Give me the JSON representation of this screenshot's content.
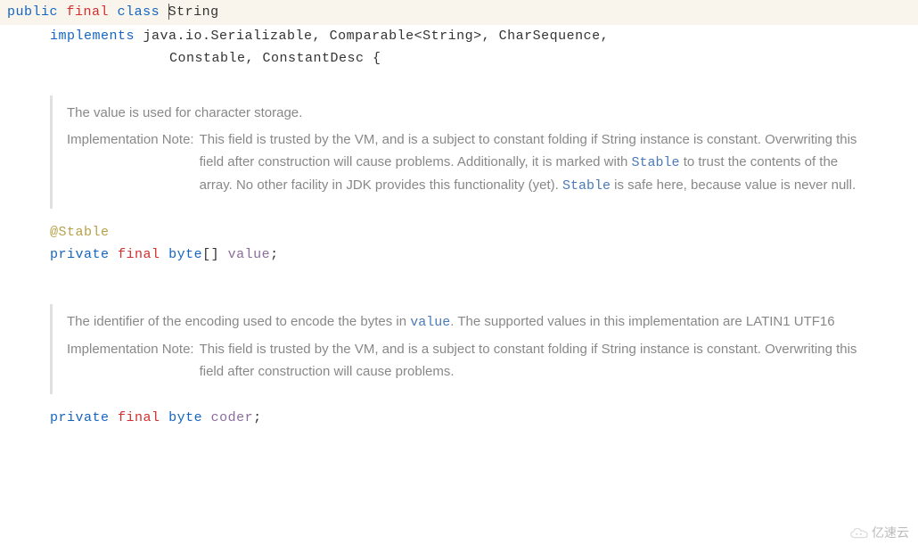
{
  "line1": {
    "public": "public",
    "final": "final",
    "class": "class",
    "name": "String"
  },
  "line2": {
    "implements": "implements",
    "types": "java.io.Serializable, Comparable<String>, CharSequence,"
  },
  "line3": {
    "types": "Constable, ConstantDesc {"
  },
  "doc1": {
    "intro": "The value is used for character storage.",
    "label": "Implementation Note:",
    "body_pre": "This field is trusted by the VM, and is a subject to constant folding if String instance is constant. Overwriting this field after construction will cause problems. Additionally, it is marked with ",
    "stable1": "Stable",
    "body_mid": " to trust the contents of the array. No other facility in JDK provides this functionality (yet). ",
    "stable2": "Stable",
    "body_post": " is safe here, because value is never null."
  },
  "decl1": {
    "annotation": "@Stable",
    "private": "private",
    "final": "final",
    "type": "byte",
    "brackets": "[]",
    "name": "value",
    "semi": ";"
  },
  "doc2": {
    "intro_pre": "The identifier of the encoding used to encode the bytes in ",
    "intro_code": "value",
    "intro_post": ". The supported values in this implementation are LATIN1 UTF16",
    "label": "Implementation Note:",
    "body": "This field is trusted by the VM, and is a subject to constant folding if String instance is constant. Overwriting this field after construction will cause problems."
  },
  "decl2": {
    "private": "private",
    "final": "final",
    "type": "byte",
    "name": "coder",
    "semi": ";"
  },
  "watermark": "亿速云"
}
